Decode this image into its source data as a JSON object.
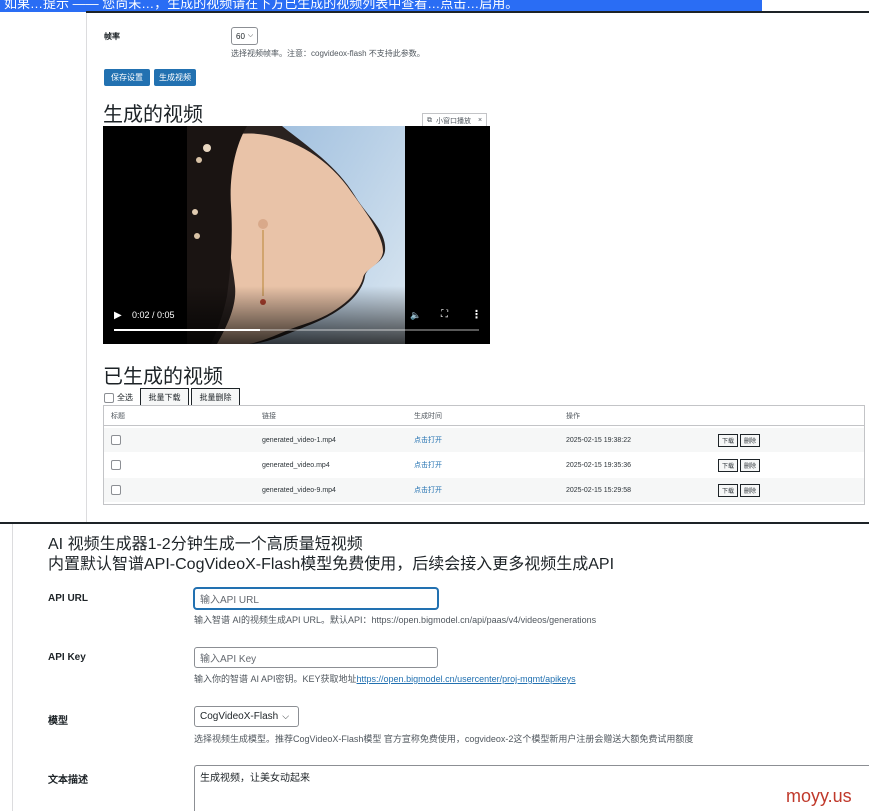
{
  "banner": {
    "text": "如果…提示 —— 您尚未…，生成的视频请在下方已生成的视频列表中查看…点击…启用。"
  },
  "framerate": {
    "label": "帧率",
    "value": "60",
    "description": "选择视频帧率。注意：cogvideox-flash 不支持此参数。"
  },
  "actions": {
    "save_label": "保存设置",
    "generate_label": "生成视频"
  },
  "generated": {
    "heading": "生成的视频",
    "pip_label": "小窗口播放",
    "player": {
      "time": "0:02 / 0:05",
      "progress": 0.4
    }
  },
  "library": {
    "heading": "已生成的视频",
    "select_all": "全选",
    "bulk_download": "批量下载",
    "bulk_delete": "批量删除",
    "columns": [
      "标题",
      "链接",
      "生成时间",
      "操作"
    ],
    "rows": [
      {
        "link": "generated_video-1.mp4",
        "open": "点击打开",
        "time": "2025-02-15 19:38:22"
      },
      {
        "link": "generated_video.mp4",
        "open": "点击打开",
        "time": "2025-02-15 19:35:36"
      },
      {
        "link": "generated_video-9.mp4",
        "open": "点击打开",
        "time": "2025-02-15 15:29:58"
      }
    ],
    "download_label": "下载",
    "delete_label": "删除"
  },
  "settings": {
    "title_line1": "AI 视频生成器1-2分钟生成一个高质量短视频",
    "title_line2": "内置默认智谱API-CogVideoX-Flash模型免费使用，后续会接入更多视频生成API",
    "api_url": {
      "label": "API URL",
      "placeholder": "输入API URL",
      "description": "输入智谱 AI的视频生成API URL。默认API：https://open.bigmodel.cn/api/paas/v4/videos/generations"
    },
    "api_key": {
      "label": "API Key",
      "placeholder": "输入API Key",
      "description_prefix": "输入你的智谱 AI API密钥。KEY获取地址",
      "description_link": "https://open.bigmodel.cn/usercenter/proj-mgmt/apikeys"
    },
    "model": {
      "label": "模型",
      "value": "CogVideoX-Flash",
      "description": "选择视频生成模型。推荐CogVideoX-Flash模型 官方宣称免费使用，cogvideox-2这个模型新用户注册会赠送大额免费试用额度"
    },
    "prompt": {
      "label": "文本描述",
      "value": "生成视频，让美女动起来"
    }
  },
  "watermark": "moyy.us",
  "colors": {
    "accent": "#2271b1",
    "banner": "#2a6df4",
    "watermark": "#c0392b"
  }
}
